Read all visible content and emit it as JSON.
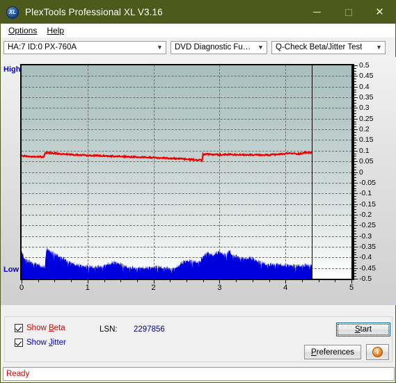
{
  "window": {
    "title": "PlexTools Professional XL V3.16",
    "logo_text": "XL",
    "minimize": "minimize-icon",
    "maximize": "maximize-icon",
    "close": "close-icon"
  },
  "menu": {
    "items": [
      {
        "label": "Options",
        "accel": "O"
      },
      {
        "label": "Help",
        "accel": "H"
      }
    ]
  },
  "toolbar": {
    "drive": "HA:7 ID:0  PX-760A",
    "function": "DVD Diagnostic Functions",
    "test": "Q-Check Beta/Jitter Test",
    "carat": "⌄"
  },
  "chart_labels": {
    "high": "High",
    "low": "Low"
  },
  "controls": {
    "show_beta": "Show Beta",
    "show_beta_accel": "B",
    "show_beta_checked": true,
    "show_jitter": "Show Jitter",
    "show_jitter_accel": "J",
    "show_jitter_checked": true,
    "lsn_label": "LSN:",
    "lsn_value": "2297856",
    "start": "Start",
    "start_accel": "S",
    "preferences": "Preferences",
    "preferences_accel": "P",
    "info": "i"
  },
  "status": {
    "text": "Ready"
  },
  "colors": {
    "titlebar": "#4d5a1c",
    "beta": "#ee0000",
    "jitter": "#0000dd",
    "axis_label": "#0000cc",
    "status_text": "#d00000"
  },
  "chart_data": {
    "type": "line",
    "title": "Q-Check Beta/Jitter Test",
    "xlabel": "",
    "ylabel": "",
    "xlim": [
      0,
      5
    ],
    "ylim": [
      -0.5,
      0.5
    ],
    "grid": true,
    "legend": "none",
    "x_ticks": [
      0,
      1,
      2,
      3,
      4,
      5
    ],
    "y_ticks": [
      0.5,
      0.45,
      0.4,
      0.35,
      0.3,
      0.25,
      0.2,
      0.15,
      0.1,
      0.05,
      0,
      -0.05,
      -0.1,
      -0.15,
      -0.2,
      -0.25,
      -0.3,
      -0.35,
      -0.4,
      -0.45,
      -0.5
    ],
    "data_end_x": 4.4,
    "axis_note_top": "High",
    "axis_note_bottom": "Low",
    "series": [
      {
        "name": "Beta",
        "color": "#ee0000",
        "x": [
          0.0,
          0.05,
          0.1,
          0.15,
          0.2,
          0.25,
          0.3,
          0.34,
          0.35,
          0.4,
          0.45,
          0.5,
          0.55,
          0.6,
          0.65,
          0.7,
          0.75,
          0.8,
          0.85,
          0.9,
          0.95,
          1.0,
          1.05,
          1.1,
          1.15,
          1.2,
          1.25,
          1.3,
          1.35,
          1.4,
          1.45,
          1.5,
          1.55,
          1.6,
          1.65,
          1.7,
          1.75,
          1.8,
          1.85,
          1.9,
          1.95,
          2.0,
          2.05,
          2.1,
          2.15,
          2.2,
          2.25,
          2.3,
          2.35,
          2.4,
          2.45,
          2.5,
          2.55,
          2.6,
          2.65,
          2.7,
          2.74,
          2.75,
          2.8,
          2.85,
          2.9,
          2.95,
          3.0,
          3.05,
          3.1,
          3.15,
          3.2,
          3.25,
          3.3,
          3.35,
          3.4,
          3.45,
          3.5,
          3.55,
          3.6,
          3.65,
          3.7,
          3.75,
          3.8,
          3.85,
          3.9,
          3.95,
          4.0,
          4.05,
          4.1,
          4.15,
          4.2,
          4.25,
          4.3,
          4.35,
          4.4
        ],
        "y": [
          0.076,
          0.075,
          0.074,
          0.073,
          0.073,
          0.072,
          0.071,
          0.07,
          0.09,
          0.09,
          0.089,
          0.088,
          0.086,
          0.085,
          0.084,
          0.083,
          0.082,
          0.081,
          0.08,
          0.08,
          0.079,
          0.078,
          0.078,
          0.077,
          0.077,
          0.076,
          0.076,
          0.075,
          0.075,
          0.074,
          0.074,
          0.073,
          0.072,
          0.072,
          0.071,
          0.071,
          0.07,
          0.07,
          0.069,
          0.069,
          0.068,
          0.068,
          0.067,
          0.066,
          0.066,
          0.065,
          0.064,
          0.064,
          0.063,
          0.062,
          0.061,
          0.06,
          0.059,
          0.058,
          0.057,
          0.056,
          0.055,
          0.082,
          0.084,
          0.083,
          0.082,
          0.082,
          0.081,
          0.081,
          0.082,
          0.083,
          0.082,
          0.081,
          0.081,
          0.08,
          0.08,
          0.081,
          0.08,
          0.08,
          0.079,
          0.079,
          0.08,
          0.08,
          0.081,
          0.082,
          0.083,
          0.084,
          0.086,
          0.088,
          0.087,
          0.086,
          0.086,
          0.087,
          0.092,
          0.091,
          0.09
        ]
      },
      {
        "name": "Jitter",
        "color": "#0000dd",
        "band_bottom": -0.5,
        "x": [
          0.0,
          0.05,
          0.1,
          0.15,
          0.2,
          0.25,
          0.3,
          0.35,
          0.38,
          0.4,
          0.45,
          0.5,
          0.55,
          0.6,
          0.65,
          0.7,
          0.75,
          0.8,
          0.85,
          0.9,
          0.95,
          1.0,
          1.05,
          1.1,
          1.15,
          1.2,
          1.25,
          1.3,
          1.35,
          1.4,
          1.45,
          1.5,
          1.55,
          1.6,
          1.65,
          1.7,
          1.75,
          1.8,
          1.85,
          1.9,
          1.95,
          2.0,
          2.05,
          2.1,
          2.15,
          2.2,
          2.25,
          2.3,
          2.35,
          2.4,
          2.45,
          2.5,
          2.55,
          2.6,
          2.65,
          2.7,
          2.75,
          2.8,
          2.85,
          2.9,
          2.95,
          3.0,
          3.05,
          3.1,
          3.15,
          3.2,
          3.25,
          3.3,
          3.35,
          3.4,
          3.45,
          3.5,
          3.55,
          3.6,
          3.65,
          3.7,
          3.75,
          3.8,
          3.85,
          3.9,
          3.95,
          4.0,
          4.05,
          4.1,
          4.15,
          4.2,
          4.25,
          4.3,
          4.35,
          4.4
        ],
        "y_top": [
          -0.375,
          -0.405,
          -0.415,
          -0.42,
          -0.425,
          -0.43,
          -0.438,
          -0.442,
          -0.355,
          -0.36,
          -0.375,
          -0.385,
          -0.39,
          -0.398,
          -0.405,
          -0.415,
          -0.422,
          -0.428,
          -0.432,
          -0.436,
          -0.44,
          -0.442,
          -0.444,
          -0.444,
          -0.442,
          -0.44,
          -0.436,
          -0.43,
          -0.424,
          -0.42,
          -0.424,
          -0.43,
          -0.44,
          -0.444,
          -0.446,
          -0.447,
          -0.447,
          -0.446,
          -0.446,
          -0.445,
          -0.446,
          -0.445,
          -0.444,
          -0.446,
          -0.447,
          -0.448,
          -0.45,
          -0.45,
          -0.445,
          -0.428,
          -0.418,
          -0.414,
          -0.416,
          -0.42,
          -0.42,
          -0.418,
          -0.395,
          -0.372,
          -0.38,
          -0.386,
          -0.375,
          -0.372,
          -0.382,
          -0.39,
          -0.368,
          -0.39,
          -0.392,
          -0.396,
          -0.4,
          -0.404,
          -0.396,
          -0.402,
          -0.412,
          -0.42,
          -0.426,
          -0.43,
          -0.432,
          -0.43,
          -0.428,
          -0.43,
          -0.432,
          -0.434,
          -0.434,
          -0.436,
          -0.44,
          -0.438,
          -0.436,
          -0.434,
          -0.432,
          -0.434
        ]
      }
    ]
  }
}
